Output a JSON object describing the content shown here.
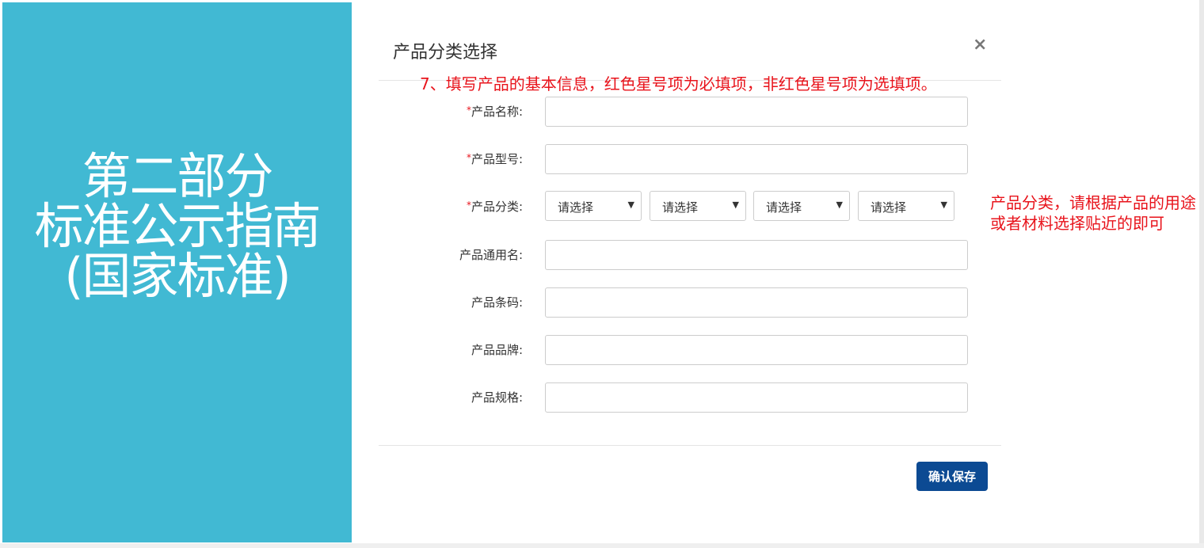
{
  "left_panel": {
    "title_lines": [
      "第二部分",
      "标准公示指南",
      "(国家标准)"
    ]
  },
  "dialog": {
    "title": "产品分类选择",
    "close_glyph": "×",
    "annotation_top": "7、填写产品的基本信息，红色星号项为必填项，非红色星号项为选填项。",
    "annotation_side": "产品分类，请根据产品的用途或者材料选择贴近的即可",
    "required_mark": "*",
    "fields": {
      "product_name": {
        "label": "产品名称:",
        "value": ""
      },
      "product_model": {
        "label": "产品型号:",
        "value": ""
      },
      "product_category": {
        "label": "产品分类:",
        "selects": [
          "请选择",
          "请选择",
          "请选择",
          "请选择"
        ],
        "arrow": "▼"
      },
      "generic_name": {
        "label": "产品通用名:",
        "value": ""
      },
      "barcode": {
        "label": "产品条码:",
        "value": ""
      },
      "brand": {
        "label": "产品品牌:",
        "value": ""
      },
      "spec": {
        "label": "产品规格:",
        "value": ""
      }
    },
    "save_label": "确认保存"
  },
  "colors": {
    "left_panel_bg": "#41b9d3",
    "annotation_red": "#e8131b",
    "save_button_bg": "#0c4a93"
  }
}
